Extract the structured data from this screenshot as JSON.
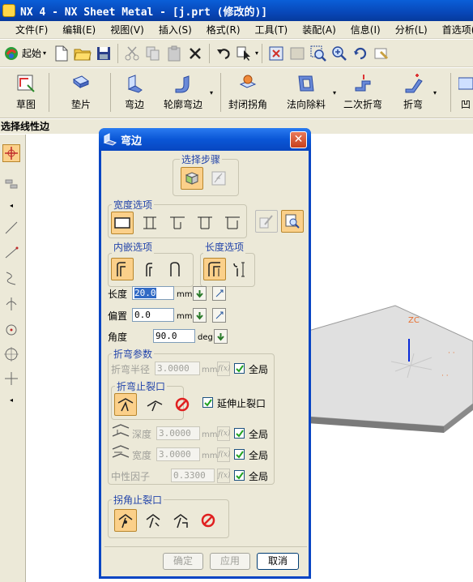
{
  "window": {
    "title": "NX 4 - NX Sheet Metal - [j.prt (修改的)]"
  },
  "menu": {
    "items": [
      "文件(F)",
      "编辑(E)",
      "视图(V)",
      "插入(S)",
      "格式(R)",
      "工具(T)",
      "装配(A)",
      "信息(I)",
      "分析(L)",
      "首选项(P)"
    ]
  },
  "toolbar": {
    "start_label": "起始"
  },
  "sheet_toolbar": {
    "items": [
      "草图",
      "垫片",
      "弯边",
      "轮廓弯边",
      "封闭拐角",
      "法向除料",
      "二次折弯",
      "折弯",
      "凹"
    ]
  },
  "prompt": "选择线性边",
  "dialog": {
    "title": "弯边",
    "steps_label": "选择步骤",
    "width_options_label": "宽度选项",
    "inset_options_label": "内嵌选项",
    "length_options_label": "长度选项",
    "length": {
      "label": "长度",
      "value": "20.0",
      "unit": "mm"
    },
    "offset": {
      "label": "偏置",
      "value": "0.0",
      "unit": "mm"
    },
    "angle": {
      "label": "角度",
      "value": "90.0",
      "unit": "deg"
    },
    "bend_params": {
      "label": "折弯参数",
      "radius_label": "折弯半径",
      "radius_value": "3.0000",
      "radius_unit": "mm",
      "global_label": "全局",
      "fx_label": "f(x)"
    },
    "bend_relief": {
      "label": "折弯止裂口",
      "extend_label": "延伸止裂口",
      "depth_label": "深度",
      "depth_value": "3.0000",
      "width_label": "宽度",
      "width_value": "3.0000",
      "unit": "mm",
      "neutral_label": "中性因子",
      "neutral_value": "0.3300",
      "global_label": "全局"
    },
    "corner_relief": {
      "label": "拐角止裂口"
    },
    "buttons": {
      "ok": "确定",
      "apply": "应用",
      "cancel": "取消"
    }
  },
  "graphics": {
    "axis_label": "ZC"
  },
  "colors": {
    "titlebar": "#0847b8",
    "dialog_border": "#0845c4",
    "selected_option": "#fbd08a",
    "plate_top": "#e0e0e0",
    "plate_edge": "#7a7a7a",
    "axis_blue": "#0a2ad8",
    "axis_label_orange": "#e87030"
  }
}
